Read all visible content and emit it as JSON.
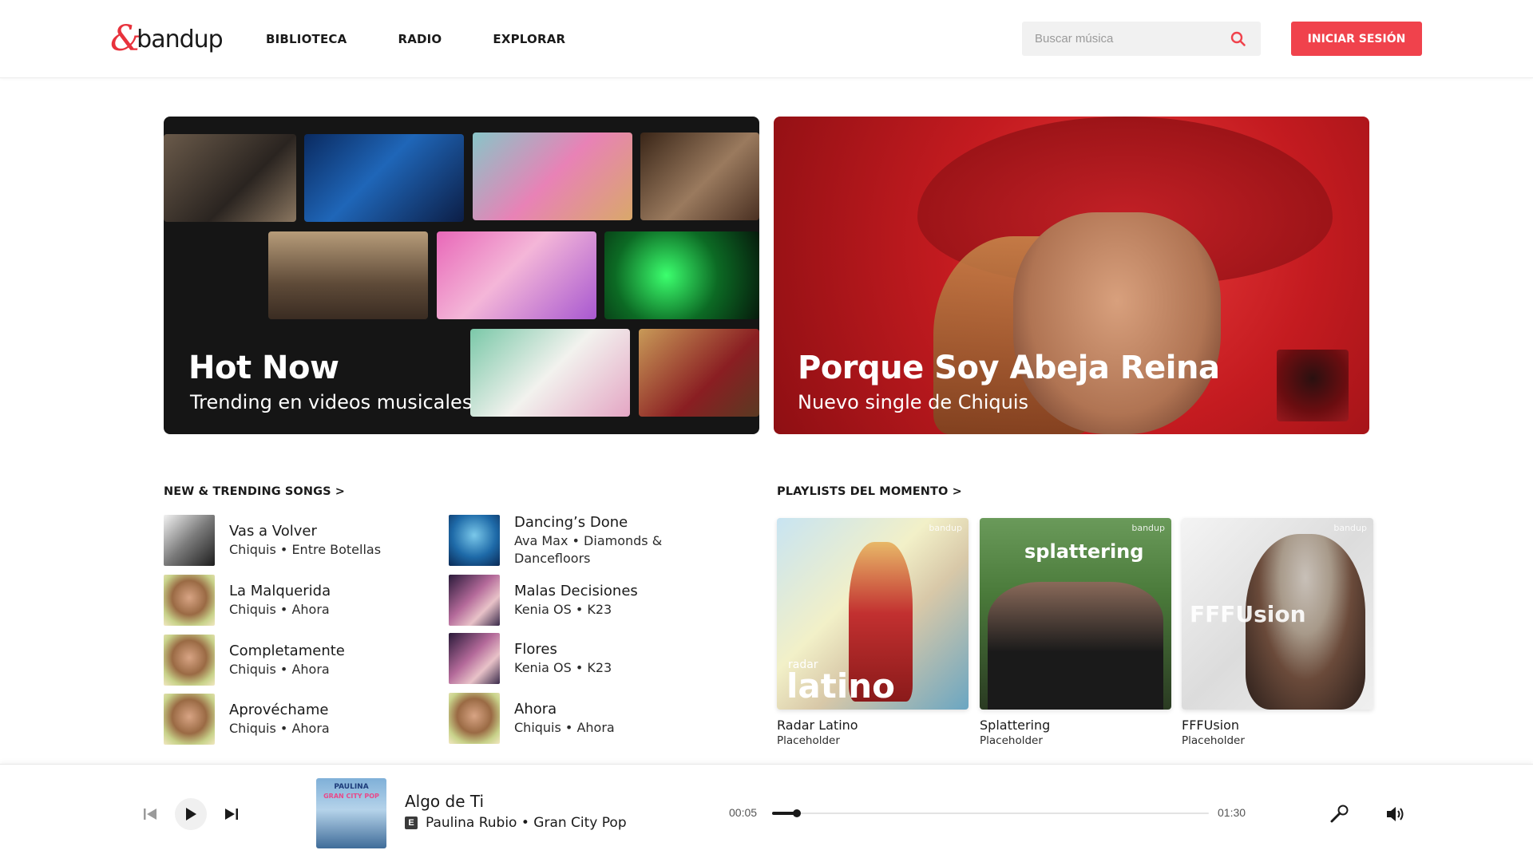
{
  "header": {
    "logo_text": "bandup",
    "logo_mark": "&",
    "nav": [
      "BIBLIOTECA",
      "RADIO",
      "EXPLORAR"
    ],
    "search_placeholder": "Buscar música",
    "login_label": "INICIAR SESIÓN",
    "accent_color": "#f0424c"
  },
  "hero": {
    "left": {
      "title": "Hot Now",
      "subtitle": "Trending en videos musicales"
    },
    "right": {
      "title": "Porque Soy Abeja Reina",
      "subtitle": "Nuevo single de Chiquis"
    }
  },
  "sections": {
    "songs_title": "NEW & TRENDING SONGS >",
    "playlists_title": "PLAYLISTS DEL MOMENTO >"
  },
  "songs": [
    {
      "title": "Vas a Volver",
      "meta": "Chiquis • Entre Botellas"
    },
    {
      "title": "La Malquerida",
      "meta": "Chiquis • Ahora"
    },
    {
      "title": "Completamente",
      "meta": "Chiquis • Ahora"
    },
    {
      "title": "Aprovéchame",
      "meta": "Chiquis • Ahora"
    },
    {
      "title": "Dancing’s Done",
      "meta": "Ava Max • Diamonds & Dancefloors"
    },
    {
      "title": "Malas Decisiones",
      "meta": "Kenia OS • K23"
    },
    {
      "title": "Flores",
      "meta": "Kenia OS • K23"
    },
    {
      "title": "Ahora",
      "meta": "Chiquis • Ahora"
    }
  ],
  "playlists": [
    {
      "name": "Radar Latino",
      "desc": "Placeholder",
      "brand": "bandup",
      "cover_text_small": "radar",
      "cover_text_big": "latino"
    },
    {
      "name": "Splattering",
      "desc": "Placeholder",
      "brand": "bandup",
      "cover_text_big": "splattering"
    },
    {
      "name": "FFFUsion",
      "desc": "Placeholder",
      "brand": "bandup",
      "cover_text_big": "FFFUsion"
    }
  ],
  "player": {
    "title": "Algo de Ti",
    "explicit": "E",
    "meta": "Paulina Rubio • Gran City Pop",
    "cover_text": "PAULINA",
    "cover_text_2": "GRAN CITY POP",
    "time_current": "00:05",
    "time_total": "01:30",
    "progress": 0.056
  }
}
